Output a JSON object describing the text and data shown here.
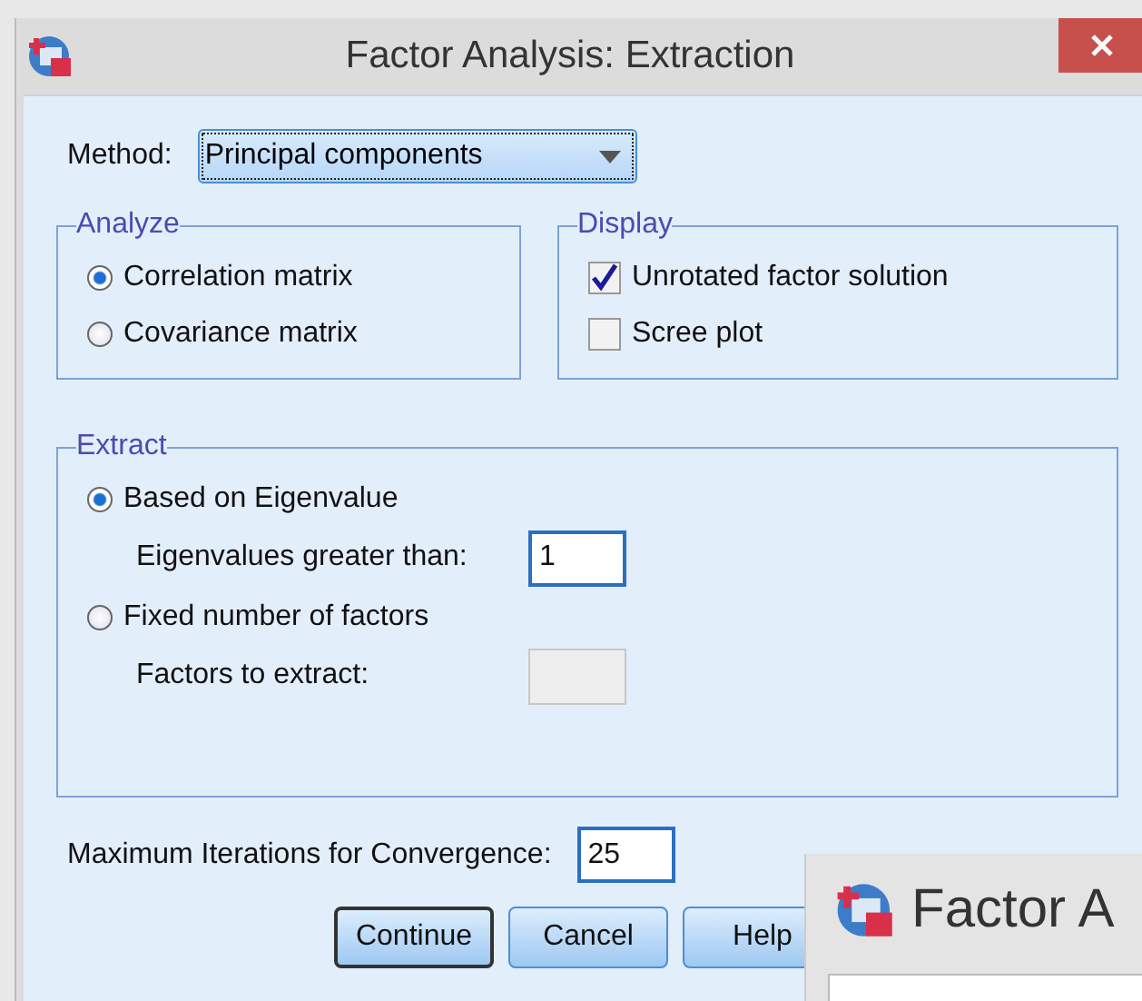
{
  "window": {
    "title": "Factor Analysis: Extraction"
  },
  "method": {
    "label": "Method:",
    "value": "Principal components"
  },
  "analyze": {
    "title": "Analyze",
    "options": [
      {
        "label": "Correlation matrix",
        "selected": true
      },
      {
        "label": "Covariance matrix",
        "selected": false
      }
    ]
  },
  "display": {
    "title": "Display",
    "options": [
      {
        "label": "Unrotated factor solution",
        "checked": true
      },
      {
        "label": "Scree plot",
        "checked": false
      }
    ]
  },
  "extract": {
    "title": "Extract",
    "options": [
      {
        "label": "Based on Eigenvalue",
        "selected": true,
        "field_label": "Eigenvalues greater than:",
        "value": "1",
        "disabled": false
      },
      {
        "label": "Fixed number of factors",
        "selected": false,
        "field_label": "Factors to extract:",
        "disabled": true
      }
    ]
  },
  "iterations": {
    "label": "Maximum Iterations for Convergence:",
    "value": "25"
  },
  "buttons": [
    {
      "label": "Continue",
      "default": true
    },
    {
      "label": "Cancel",
      "default": false
    },
    {
      "label": "Help",
      "default": false
    }
  ],
  "background_window": {
    "title": "Factor A"
  }
}
